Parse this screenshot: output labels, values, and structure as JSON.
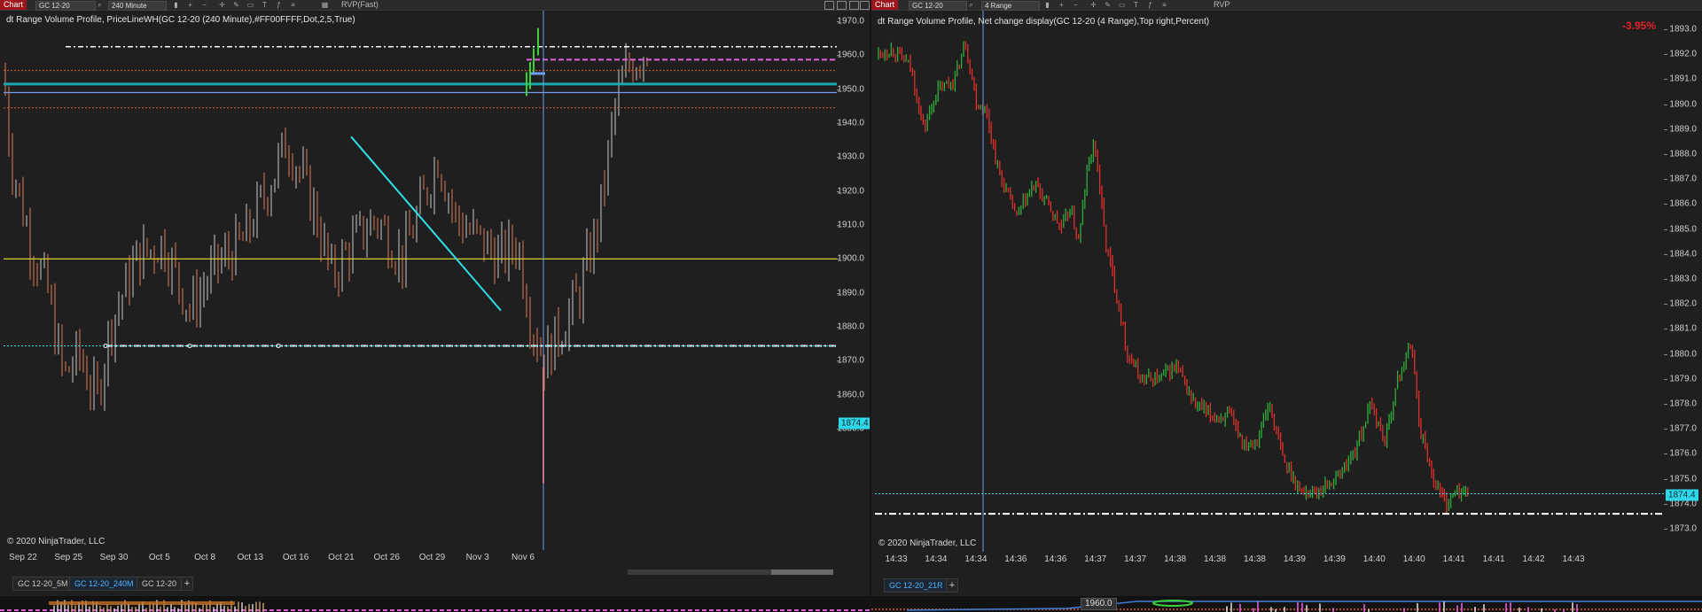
{
  "left": {
    "toolbar": {
      "chart_label": "Chart",
      "instrument": "GC 12-20",
      "interval": "240 Minute",
      "indicator": "RVP(Fast)"
    },
    "title": "dt Range Volume Profile, PriceLineWH(GC 12-20 (240 Minute),#FF00FFFF,Dot,2,5,True)",
    "copyright": "© 2020 NinjaTrader, LLC",
    "price_tag": "1874.4",
    "y_labels": [
      "1970.0",
      "1960.0",
      "1950.0",
      "1940.0",
      "1930.0",
      "1920.0",
      "1910.0",
      "1900.0",
      "1890.0",
      "1880.0",
      "1870.0",
      "1860.0",
      "1850.0"
    ],
    "x_labels": [
      "Sep 22",
      "Sep 25",
      "Sep 30",
      "Oct 5",
      "Oct 8",
      "Oct 13",
      "Oct 16",
      "Oct 21",
      "Oct 26",
      "Oct 29",
      "Nov 3",
      "Nov 6"
    ],
    "tabs": [
      "GC 12-20_5M",
      "GC 12-20_240M",
      "GC 12-20"
    ],
    "active_tab": 1
  },
  "right": {
    "toolbar": {
      "chart_label": "Chart",
      "instrument": "GC 12-20",
      "interval": "4 Range",
      "indicator": "RVP"
    },
    "title": "dt Range Volume Profile, Net change display(GC 12-20 (4 Range),Top right,Percent)",
    "net_change": "-3.95%",
    "copyright": "© 2020 NinjaTrader, LLC",
    "price_tag": "1874.4",
    "y_labels": [
      "1893.0",
      "1892.0",
      "1891.0",
      "1890.0",
      "1889.0",
      "1888.0",
      "1887.0",
      "1886.0",
      "1885.0",
      "1884.0",
      "1883.0",
      "1882.0",
      "1881.0",
      "1880.0",
      "1879.0",
      "1878.0",
      "1877.0",
      "1876.0",
      "1875.0",
      "1874.0",
      "1873.0"
    ],
    "x_labels": [
      "14:33",
      "14:34",
      "14:34",
      "14:36",
      "14:36",
      "14:37",
      "14:37",
      "14:38",
      "14:38",
      "14:38",
      "14:39",
      "14:39",
      "14:40",
      "14:40",
      "14:41",
      "14:41",
      "14:42",
      "14:43"
    ],
    "tabs": [
      "GC 12-20_21R"
    ],
    "active_tab": 0,
    "bottom_value": "1960.0"
  },
  "colors": {
    "background": "#1f1f1f",
    "up_candle": "#2fae3a",
    "down_candle": "#e0302a",
    "left_up_candle": "#c8c8c8",
    "left_down_candle": "#e07a5a",
    "trendline": "#2fe0e8",
    "yellow_line": "#e6e62a",
    "teal_line": "#1aa9b0",
    "blue_line": "#6f9ee6",
    "orange_dots": "#e0602a",
    "magenta_line": "#e060e0",
    "white_dashdot": "#ffffff",
    "net_change": "#e0202a",
    "price_tag_bg": "#2fd7ea"
  }
}
